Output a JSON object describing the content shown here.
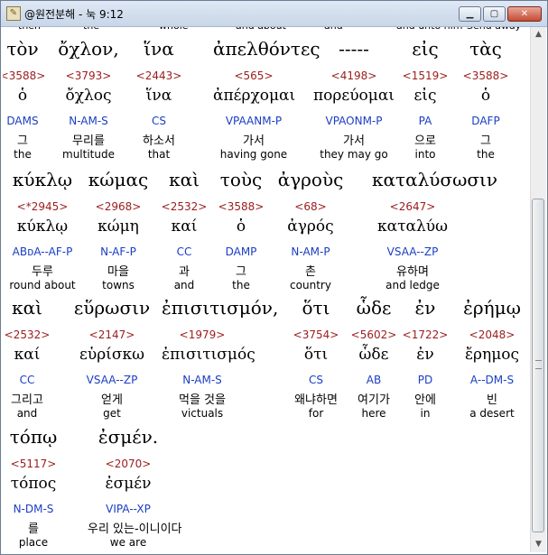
{
  "window": {
    "title": "@원전분해 - 눅 9:12"
  },
  "rows": [
    {
      "words": [
        {
          "greek": "τὸν",
          "strong": "<3588>",
          "lemma": "ὁ",
          "morph": "DAMS",
          "kor": "그",
          "eng": "the"
        },
        {
          "greek": "ὄχλον,",
          "strong": "<3793>",
          "lemma": "ὄχλος",
          "morph": "N-AM-S",
          "kor": "무리를",
          "eng": "multitude"
        },
        {
          "greek": "ἵνα",
          "strong": "<2443>",
          "lemma": "ἵνα",
          "morph": "CS",
          "kor": "하소서",
          "eng": "that"
        },
        {
          "greek": "ἀπελθόντες",
          "strong": "<565>",
          "lemma": "ἀπέρχομαι",
          "morph": "VPAANM-P",
          "kor": "가서",
          "eng": "having gone"
        },
        {
          "greek": "-----",
          "strong": "<4198>",
          "lemma": "πορεύομαι",
          "morph": "VPAONM-P",
          "kor": "가서",
          "eng": "they may go"
        },
        {
          "greek": "εἰς",
          "strong": "<1519>",
          "lemma": "εἰς",
          "morph": "PA",
          "kor": "으로",
          "eng": "into"
        },
        {
          "greek": "τὰς",
          "strong": "<3588>",
          "lemma": "ὁ",
          "morph": "DAFP",
          "kor": "그",
          "eng": "the"
        }
      ]
    },
    {
      "words": [
        {
          "greek": "κύκλῳ",
          "strong": "<*2945>",
          "lemma": "κύκλῳ",
          "morph": "ABᴅA--AF-P",
          "kor": "두루",
          "eng": "round about"
        },
        {
          "greek": "κώμας",
          "strong": "<2968>",
          "lemma": "κώμη",
          "morph": "N-AF-P",
          "kor": "마을",
          "eng": "towns"
        },
        {
          "greek": "καὶ",
          "strong": "<2532>",
          "lemma": "καί",
          "morph": "CC",
          "kor": "과",
          "eng": "and"
        },
        {
          "greek": "τοὺς",
          "strong": "<3588>",
          "lemma": "ὁ",
          "morph": "DAMP",
          "kor": "그",
          "eng": "the"
        },
        {
          "greek": "ἀγροὺς",
          "strong": "<68>",
          "lemma": "ἀγρός",
          "morph": "N-AM-P",
          "kor": "촌",
          "eng": "country"
        },
        {
          "greek": "καταλύσωσιν",
          "strong": "<2647>",
          "lemma": "καταλύω",
          "morph": "VSAA--ZP",
          "kor": "유하며",
          "eng": "and ledge"
        }
      ]
    },
    {
      "words": [
        {
          "greek": "καὶ",
          "strong": "<2532>",
          "lemma": "καί",
          "morph": "CC",
          "kor": "그리고",
          "eng": "and"
        },
        {
          "greek": "εὕρωσιν",
          "strong": "<2147>",
          "lemma": "εὑρίσκω",
          "morph": "VSAA--ZP",
          "kor": "얻게",
          "eng": "get"
        },
        {
          "greek": "ἐπισιτισμόν,",
          "strong": "<1979>",
          "lemma": "ἐπισιτισμός",
          "morph": "N-AM-S",
          "kor": "먹을 것을",
          "eng": "victuals"
        },
        {
          "greek": "ὅτι",
          "strong": "<3754>",
          "lemma": "ὅτι",
          "morph": "CS",
          "kor": "왜냐하면",
          "eng": "for"
        },
        {
          "greek": "ὧδε",
          "strong": "<5602>",
          "lemma": "ὧδε",
          "morph": "AB",
          "kor": "여기가",
          "eng": "here"
        },
        {
          "greek": "ἐν",
          "strong": "<1722>",
          "lemma": "ἐν",
          "morph": "PD",
          "kor": "안에",
          "eng": "in"
        },
        {
          "greek": "ἐρήμῳ",
          "strong": "<2048>",
          "lemma": "ἔρημος",
          "morph": "A--DM-S",
          "kor": "빈",
          "eng": "a desert"
        }
      ]
    },
    {
      "words": [
        {
          "greek": "τόπῳ",
          "strong": "<5117>",
          "lemma": "τόπος",
          "morph": "N-DM-S",
          "kor": "를",
          "eng": "place"
        },
        {
          "greek": "ἐσμέν.",
          "strong": "<2070>",
          "lemma": "ἐσμέν",
          "morph": "VIPA--XP",
          "kor": "우리 있는-이니이다",
          "eng": "we are"
        }
      ]
    }
  ],
  "ghost_text": [
    "then",
    "the",
    "whole",
    "and about",
    "and",
    "and unto him",
    "Send away"
  ],
  "colors": {
    "greek": "#000000",
    "strong": "#9b1c1c",
    "morph": "#1a3ec4",
    "gloss": "#000000"
  }
}
